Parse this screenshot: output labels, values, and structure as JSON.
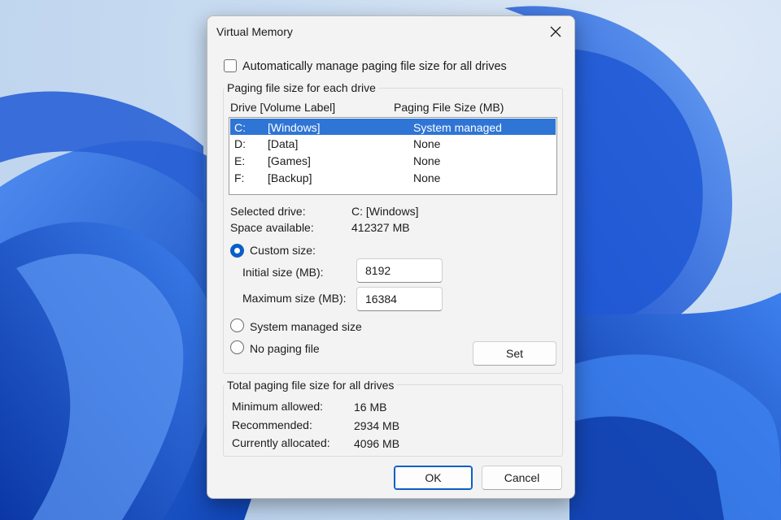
{
  "window": {
    "title": "Virtual Memory"
  },
  "auto_manage": {
    "label": "Automatically manage paging file size for all drives",
    "checked": false
  },
  "drives_group": {
    "legend": "Paging file size for each drive",
    "header_drive": "Drive  [Volume Label]",
    "header_size": "Paging File Size (MB)",
    "rows": [
      {
        "drive": "C:",
        "label": "[Windows]",
        "size": "System managed",
        "selected": true
      },
      {
        "drive": "D:",
        "label": "[Data]",
        "size": "None",
        "selected": false
      },
      {
        "drive": "E:",
        "label": "[Games]",
        "size": "None",
        "selected": false
      },
      {
        "drive": "F:",
        "label": "[Backup]",
        "size": "None",
        "selected": false
      }
    ],
    "selected_drive_label": "Selected drive:",
    "selected_drive_value": "C:  [Windows]",
    "space_label": "Space available:",
    "space_value": "412327 MB",
    "custom_size_label": "Custom size:",
    "initial_label": "Initial size (MB):",
    "initial_value": "8192",
    "maximum_label": "Maximum size (MB):",
    "maximum_value": "16384",
    "system_managed_label": "System managed size",
    "no_paging_label": "No paging file",
    "selected_option": "custom",
    "set_label": "Set"
  },
  "totals_group": {
    "legend": "Total paging file size for all drives",
    "min_label": "Minimum allowed:",
    "min_value": "16 MB",
    "rec_label": "Recommended:",
    "rec_value": "2934 MB",
    "cur_label": "Currently allocated:",
    "cur_value": "4096 MB"
  },
  "buttons": {
    "ok": "OK",
    "cancel": "Cancel"
  },
  "colors": {
    "accent": "#0a5ec7",
    "selection": "#2f75d5",
    "wallpaper_blue": "#1a5bd8"
  }
}
